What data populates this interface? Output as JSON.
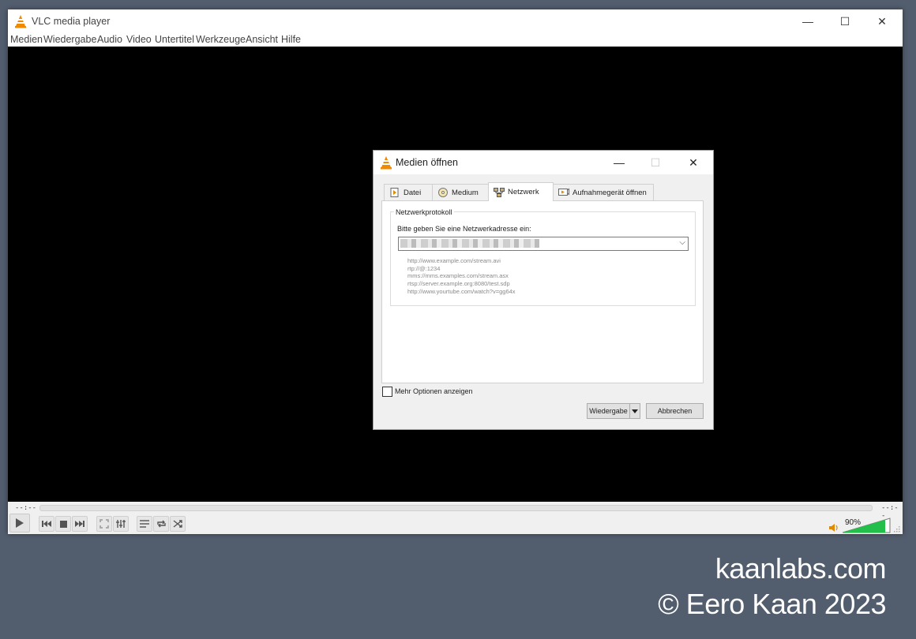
{
  "window": {
    "title": "VLC media player",
    "min_glyph": "—",
    "max_glyph": "☐",
    "close_glyph": "✕"
  },
  "menu": [
    "Medien",
    "Wiedergabe",
    "Audio",
    "Video",
    "Untertitel",
    "Werkzeuge",
    "Ansicht",
    "Hilfe"
  ],
  "controls": {
    "time_elapsed": "--:--",
    "time_total": "--:--",
    "volume": "90%",
    "volume_level": 0.9
  },
  "dialog": {
    "title": "Medien öffnen",
    "tabs": [
      "Datei",
      "Medium",
      "Netzwerk",
      "Aufnahmegerät öffnen"
    ],
    "active_tab": "Netzwerk",
    "group_title": "Netzwerkprotokoll",
    "field_label": "Bitte geben Sie eine Netzwerkadresse ein:",
    "examples": [
      "http://www.example.com/stream.avi",
      "rtp://@:1234",
      "mms://mms.examples.com/stream.asx",
      "rtsp://server.example.org:8080/test.sdp",
      "http://www.yourtube.com/watch?v=gg64x"
    ],
    "more_options_label": "Mehr Optionen anzeigen",
    "play_button": "Wiedergabe",
    "cancel_button": "Abbrechen"
  },
  "watermark": {
    "line1": "kaanlabs.com",
    "line2": "© Eero Kaan 2023"
  },
  "colors": {
    "desktop": "#525d6e",
    "vlc_orange": "#f08a00",
    "volume_green": "#22c04a"
  }
}
